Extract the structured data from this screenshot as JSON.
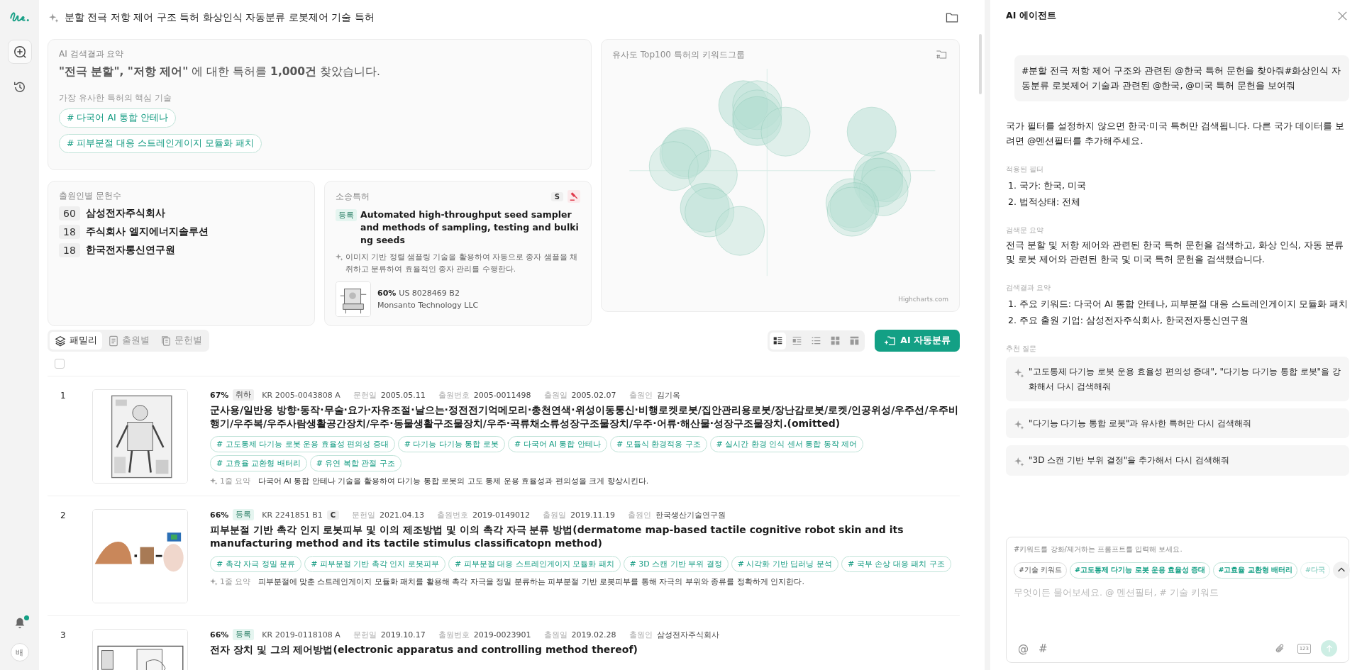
{
  "sidebar": {
    "nav_items": [
      {
        "kind": "new-search",
        "selected": true
      },
      {
        "kind": "history",
        "selected": false
      }
    ],
    "notifications": {
      "unread": true
    },
    "avatar": "배"
  },
  "header": {
    "title": "분할 전극 저항 제어 구조 특허 화상인식 자동분류 로봇제어 기술 특허"
  },
  "summary_card": {
    "label": "AI 검색결과 요약",
    "headline": "**\"전극 분할\", \"저항 제어\"** 에 대한 특허를 **1,000건** 찾았습니다.",
    "sub_label": "가장 유사한 특허의 핵심 기술",
    "tags": [
      "# 다국어 AI 통합 안테나",
      "# 피부분절 대응 스트레인게이지 모듈화 패치"
    ]
  },
  "applicant_card": {
    "label": "출원인별 문헌수",
    "rows": [
      {
        "count": "60",
        "name": "삼성전자주식회사"
      },
      {
        "count": "18",
        "name": "주식회사 엘지에너지솔루션"
      },
      {
        "count": "18",
        "name": "한국전자통신연구원"
      }
    ]
  },
  "litigation_card": {
    "label": "소송특허",
    "badge": "S",
    "status": {
      "label": "등록",
      "color": "#e5f5f0"
    },
    "title": "Automated high-throughput seed sampler and methods of sampling, testing and bulking seeds",
    "summary": "이미지 기반 정렬 샘플링 기술을 활용하여 자동으로 종자 샘플을 채취하고 분류하여 효율적인 종자 관리를 수행한다.",
    "image": {
      "kind": "picture"
    },
    "similarity": "60%",
    "number": "US 8028469 B2",
    "applicant": "Monsanto Technology LLC"
  },
  "chart_card": {
    "title": "유사도 Top100 특허의 키워드그룹",
    "credit": "Highcharts.com"
  },
  "toolbar": {
    "tabs": [
      {
        "label": "패밀리",
        "kind": "family",
        "selected": true
      },
      {
        "label": "출원별",
        "kind": "application",
        "selected": false
      },
      {
        "label": "문헌별",
        "kind": "document",
        "selected": false
      }
    ],
    "views": [
      {
        "kind": "card-list",
        "selected": true
      },
      {
        "kind": "compact",
        "selected": false
      },
      {
        "kind": "list",
        "selected": false
      },
      {
        "kind": "grid",
        "selected": false
      },
      {
        "kind": "table",
        "selected": false
      }
    ],
    "action": "AI 자동분류"
  },
  "select_all": {
    "checked": false
  },
  "results": [
    {
      "rank": "1",
      "image": {
        "kind": "picture"
      },
      "similarity": "67%",
      "status": {
        "label": "취하",
        "color": "#eeeeee"
      },
      "number": "KR 2005-0043808 A",
      "meta": [
        {
          "label": "문헌일",
          "value": "2005.05.11"
        },
        {
          "label": "출원번호",
          "value": "2005-0011498"
        },
        {
          "label": "출원일",
          "value": "2005.02.07"
        },
        {
          "label": "출원인",
          "value": "김기옥"
        }
      ],
      "title": "군사용/일반용 방향·동작·무술·요가·자유조절·날으는·정전전기억메모리·총천연색·위성이동통신·비행로켓로봇/집안관리용로봇/장난감로봇/로켓/인공위성/우주선/우주비행기/우주복/우주사람생활공간장치/우주·동물생활구조물장치/우주·곡류채소류성장구조물장치/우주·어류·해산물·성장구조물장치.(omitted)",
      "tags": [
        "# 고도통제 다기능 로봇 운용 효율성 편의성 증대",
        "# 다기능 다기능 통합 로봇",
        "# 다국어 AI 통합 안테나",
        "# 모듈식 환경적응 구조",
        "# 실시간 환경 인식 센서 통합 동작 제어",
        "# 고효율 교환형 배터리",
        "# 유연 복합 관절 구조"
      ],
      "summary_label": "1줄 요약",
      "summary": "다국어 AI 통합 안테나 기술을 활용하여 다기능 통합 로봇의 고도 통제 운용 효율성과 편의성을 크게 향상시킨다."
    },
    {
      "rank": "2",
      "image": {
        "kind": "picture"
      },
      "similarity": "66%",
      "status": {
        "label": "등록",
        "color": "#e5f5f0"
      },
      "number": "KR 2241851 B1",
      "badge": "C",
      "meta": [
        {
          "label": "문헌일",
          "value": "2021.04.13"
        },
        {
          "label": "출원번호",
          "value": "2019-0149012"
        },
        {
          "label": "출원일",
          "value": "2019.11.19"
        },
        {
          "label": "출원인",
          "value": "한국생산기술연구원"
        }
      ],
      "title": "피부분절 기반 촉각 인지 로봇피부 및 이의 제조방법 및 이의 촉각 자극 분류 방법(dermatome map-based tactile cognitive robot skin and its manufacturing method and its tactile stimulus classificatopn method)",
      "tags": [
        "# 촉각 자극 정밀 분류",
        "# 피부분절 기반 촉각 인지 로봇피부",
        "# 피부분절 대응 스트레인게이지 모듈화 패치",
        "# 3D 스캔 기반 부위 결정",
        "# 시각화 기반 딥러닝 분석",
        "# 국부 손상 대응 패치 구조"
      ],
      "summary_label": "1줄 요약",
      "summary": "피부분절에 맞춘 스트레인게이지 모듈화 패치를 활용해 촉각 자극을 정밀 분류하는 피부분절 기반 로봇피부를 통해 자극의 부위와 종류를 정확하게 인지한다."
    },
    {
      "rank": "3",
      "image": {
        "kind": "picture"
      },
      "similarity": "66%",
      "status": {
        "label": "등록",
        "color": "#e5f5f0"
      },
      "number": "KR 2019-0118108 A",
      "meta": [
        {
          "label": "문헌일",
          "value": "2019.10.17"
        },
        {
          "label": "출원번호",
          "value": "2019-0023901"
        },
        {
          "label": "출원일",
          "value": "2019.02.28"
        },
        {
          "label": "출원인",
          "value": "삼성전자주식회사"
        }
      ],
      "title": "전자 장치 및 그의 제어방법(electronic apparatus and controlling method thereof)"
    }
  ],
  "agent": {
    "title": "AI 에이전트",
    "user_message": "#분할 전극 저항 제어 구조와 관련된 @한국 특허 문헌을 찾아줘#화상인식 자동분류 로봇제어 기술과 관련된 @한국, @미국 특허 문헌을 보여줘",
    "answer": "국가 필터를 설정하지 않으면 한국·미국 특허만 검색됩니다. 다른 국가 데이터를 보려면 @멘션필터를 추가해주세요.",
    "sections": [
      {
        "label": "적용된 필터",
        "kind": "list",
        "items": [
          "1. 국가: 한국, 미국",
          "2. 법적상태: 전체"
        ]
      },
      {
        "label": "검색문 요약",
        "kind": "paragraph",
        "text": "전극 분할 및 저항 제어와 관련된 한국 특허 문헌을 검색하고, 화상 인식, 자동 분류 및 로봇 제어와 관련된 한국 및 미국 특허 문헌을 검색했습니다."
      },
      {
        "label": "검색결과 요약",
        "kind": "list",
        "items": [
          "1. 주요 키워드: 다국어 AI 통합 안테나, 피부분절 대응 스트레인게이지 모듈화 패치",
          "2. 주요 출원 기업: 삼성전자주식회사, 한국전자통신연구원"
        ]
      },
      {
        "label": "추천 질문",
        "kind": "suggestions",
        "items": [
          "\"고도통제 다기능 로봇 운용 효율성 편의성 증대\", \"다기능 다기능 통합 로봇\"을 강화해서 다시 검색해줘",
          "\"다기능 다기능 통합 로봇\"과 유사한 특허만 다시 검색해줘",
          "\"3D 스캔 기반 부위 결정\"을 추가해서 다시 검색해줘"
        ]
      }
    ],
    "composer": {
      "hint": "#키워드를 강화/제거하는 프롬프트를 입력해 보세요.",
      "chips": [
        {
          "label": "#기술 키워드",
          "kind": "category"
        },
        {
          "label": "#고도통제 다기능 로봇 운용 효율성 증대",
          "kind": "keyword"
        },
        {
          "label": "#고효율 교환형 배터리",
          "kind": "keyword"
        },
        {
          "label": "#다국",
          "kind": "faded"
        }
      ],
      "placeholder": "무엇이든 물어보세요. @ 멘션필터, # 기술 키워드",
      "mention": "@",
      "hash": "#",
      "number_tool": "123",
      "send_disabled": true
    }
  }
}
